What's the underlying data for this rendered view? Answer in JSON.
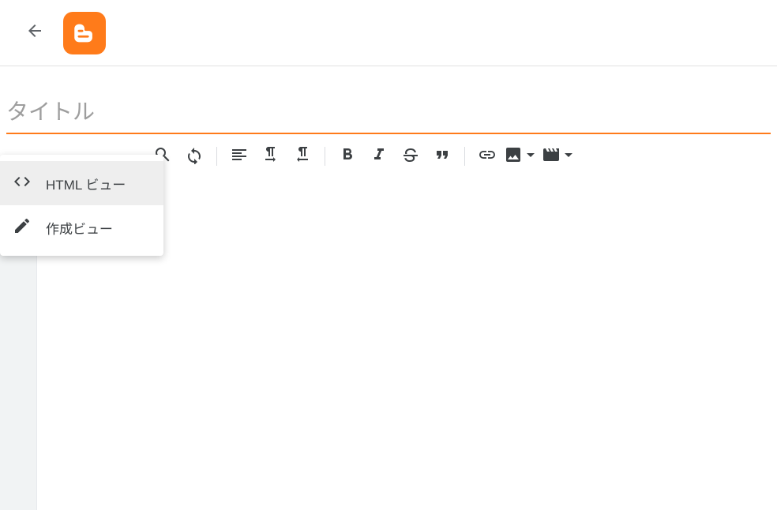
{
  "header": {
    "back_label": "back"
  },
  "title": {
    "placeholder": "タイトル",
    "value": ""
  },
  "view_menu": {
    "items": [
      {
        "label": "HTML ビュー",
        "selected": true
      },
      {
        "label": "作成ビュー",
        "selected": false
      }
    ]
  },
  "toolbar": {
    "search": "search",
    "refresh": "refresh",
    "align": "align",
    "ltr": "left-to-right",
    "rtl": "right-to-left",
    "bold": "bold",
    "italic": "italic",
    "strike": "strikethrough",
    "quote": "quote",
    "link": "link",
    "image": "insert-image",
    "video": "insert-video"
  }
}
